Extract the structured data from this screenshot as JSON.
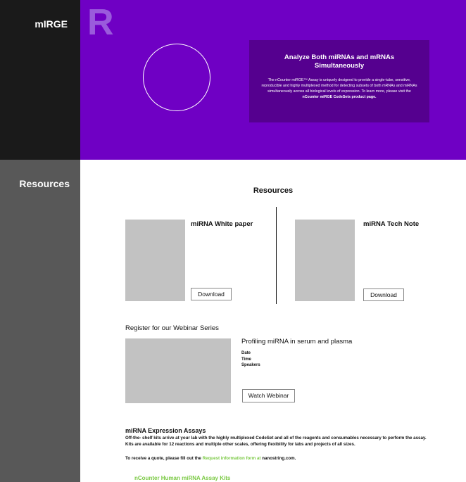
{
  "hero": {
    "sidebar_title": "mIRGE",
    "logo_letter": "R",
    "card_heading": "Analyze Both miRNAs and mRNAs Simultaneously",
    "card_text": "The nCounter miRGE™ Assay is uniquely designed to provide a single-tube, sensitive, reproducible and highly multiplexed method for detecting subsets of both mRNAs and miRNAs simultaneously across all biological levels of expression. To learn more, please visit the",
    "card_link": "nCounter miRGE CodeSets product page."
  },
  "resources": {
    "sidebar_title": "Resources",
    "heading": "Resources",
    "items": [
      {
        "title": "miRNA White paper",
        "button": "Download"
      },
      {
        "title": "miRNA Tech Note",
        "button": "Download"
      }
    ]
  },
  "webinar": {
    "section_title": "Register for our Webinar Series",
    "title": "Profiling miRNA in serum and plasma",
    "date_label": "Date",
    "time_label": "Time",
    "speakers_label": "Speakers",
    "button": "Watch Webinar"
  },
  "assays": {
    "title": "miRNA Expression Assays",
    "description": "Off-the- shelf kits arrive at your lab with the highly multiplexed CodeSet and all of the reagents and consumables necessary to perform the assay. Kits are available for 12 reactions and multiple other scales, offering flexibility for labs and projects of all sizes.",
    "quote_prefix": "To receive a quote, please fill out the",
    "quote_link": "Request information form at",
    "quote_suffix": "nanostring.com.",
    "kit_link": "nCounter Human miRNA Assay Kits"
  },
  "colors": {
    "hero_purple": "#6f00c4",
    "card_purple": "#55008f",
    "dark_sidebar": "#1a1a1a",
    "gray_sidebar": "#585858",
    "link_green": "#7ac943"
  }
}
